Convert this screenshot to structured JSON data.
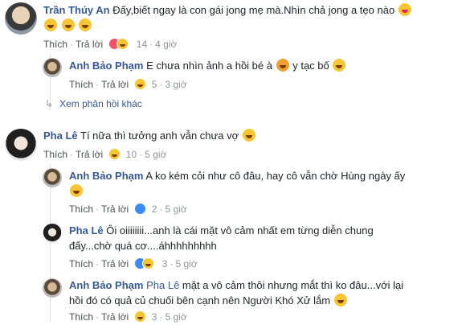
{
  "comments": [
    {
      "name": "Trần Thúy An",
      "text_line1": "Đấy,biết ngay là con gái jong mẹ mà.Nhìn chả jong a tẹo nào",
      "actions": {
        "like": "Thích",
        "reply": "Trả lời",
        "count": "14",
        "time": "4 giờ"
      },
      "replies": [
        {
          "name": "Anh Bảo Phạm",
          "text_before": "E chưa nhìn ảnh a hồi bé à",
          "text_after": "y tạc bố",
          "actions": {
            "like": "Thích",
            "reply": "Trả lời",
            "count": "5",
            "time": "3 giờ"
          }
        }
      ],
      "more_replies": "Xem phản hồi khác"
    },
    {
      "name": "Pha Lê",
      "text_line1": "Tí nữa thì tưởng anh vẫn chưa vợ",
      "actions": {
        "like": "Thích",
        "reply": "Trả lời",
        "count": "10",
        "time": "5 giờ"
      },
      "replies": [
        {
          "name": "Anh Bảo Phạm",
          "text_line1": "A ko kém cỏi như cô đâu, hay cô vẫn chờ Hùng ngày ấy",
          "actions": {
            "like": "Thích",
            "reply": "Trả lời",
            "count": "2",
            "time": "5 giờ"
          }
        },
        {
          "name": "Pha Lê",
          "text_line1": "Ôi oiiiiiiii...anh là cái mặt vô cảm nhất em từng diễn chung",
          "text_line2": "đấy...chờ quá cơ....áhhhhhhhhh",
          "actions": {
            "like": "Thích",
            "reply": "Trả lời",
            "count": "3",
            "time": "5 giờ"
          }
        },
        {
          "name": "Anh Bảo Phạm",
          "mention": "Pha Lê",
          "text_line1": "mặt a vô cảm thôi nhưng mắt thì ko đâu...với lại",
          "text_line2": "hồi đó có quả củ chuối bên cạnh nên Người Khó Xử lắm",
          "actions": {
            "like": "Thích",
            "reply": "Trả lời",
            "count": "3",
            "time": "5 giờ"
          }
        }
      ]
    }
  ]
}
